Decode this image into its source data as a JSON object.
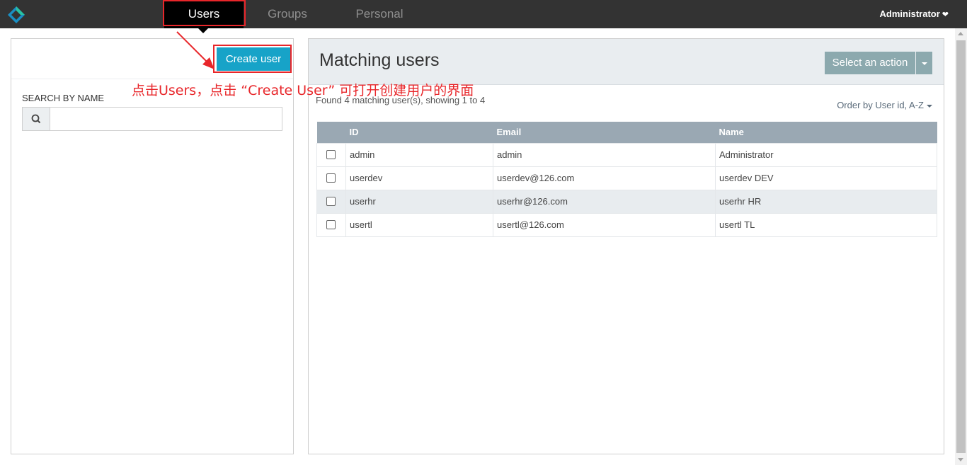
{
  "nav": {
    "tabs": [
      {
        "label": "Users",
        "active": true
      },
      {
        "label": "Groups",
        "active": false
      },
      {
        "label": "Personal",
        "active": false
      }
    ],
    "user_menu": "Administrator"
  },
  "annotation": {
    "text": "点击Users，点击 “Create User” 可打开创建用户的界面",
    "color": "#e8262a"
  },
  "left_panel": {
    "create_button": "Create user",
    "search_label": "SEARCH BY NAME",
    "search_value": ""
  },
  "right_panel": {
    "title": "Matching users",
    "action_button": "Select an action",
    "found_text": "Found 4 matching user(s), showing 1 to 4",
    "order_by": "Order by User id, A-Z",
    "columns": [
      "ID",
      "Email",
      "Name"
    ],
    "rows": [
      {
        "id": "admin",
        "email": "admin",
        "name": "Administrator"
      },
      {
        "id": "userdev",
        "email": "userdev@126.com",
        "name": "userdev DEV"
      },
      {
        "id": "userhr",
        "email": "userhr@126.com",
        "name": "userhr HR"
      },
      {
        "id": "usertl",
        "email": "usertl@126.com",
        "name": "usertl TL"
      }
    ]
  },
  "colors": {
    "topbar": "#333333",
    "accent": "#17a3c8",
    "action_button": "#8ca9ae",
    "table_header": "#9aa8b3"
  }
}
